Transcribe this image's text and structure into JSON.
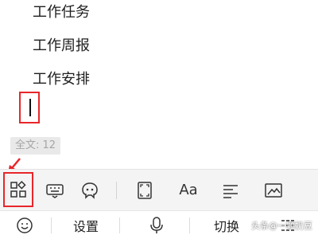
{
  "editor": {
    "lines": [
      "工作任务",
      "工作周报",
      "工作安排"
    ],
    "word_count": "全文: 12"
  },
  "toolbar": {
    "icons": [
      "apps-grid-icon",
      "keyboard-icon",
      "sticker-icon",
      "fullscreen-icon",
      "text-format-icon",
      "align-icon",
      "image-icon"
    ],
    "text_format_glyph": "Aa"
  },
  "keyboard_bar": {
    "settings_label": "设置",
    "switch_label": "切换"
  },
  "watermark": "头条@一颗奶豆",
  "colors": {
    "highlight": "#e8262a",
    "toolbar_bg": "#f4f4f4"
  }
}
